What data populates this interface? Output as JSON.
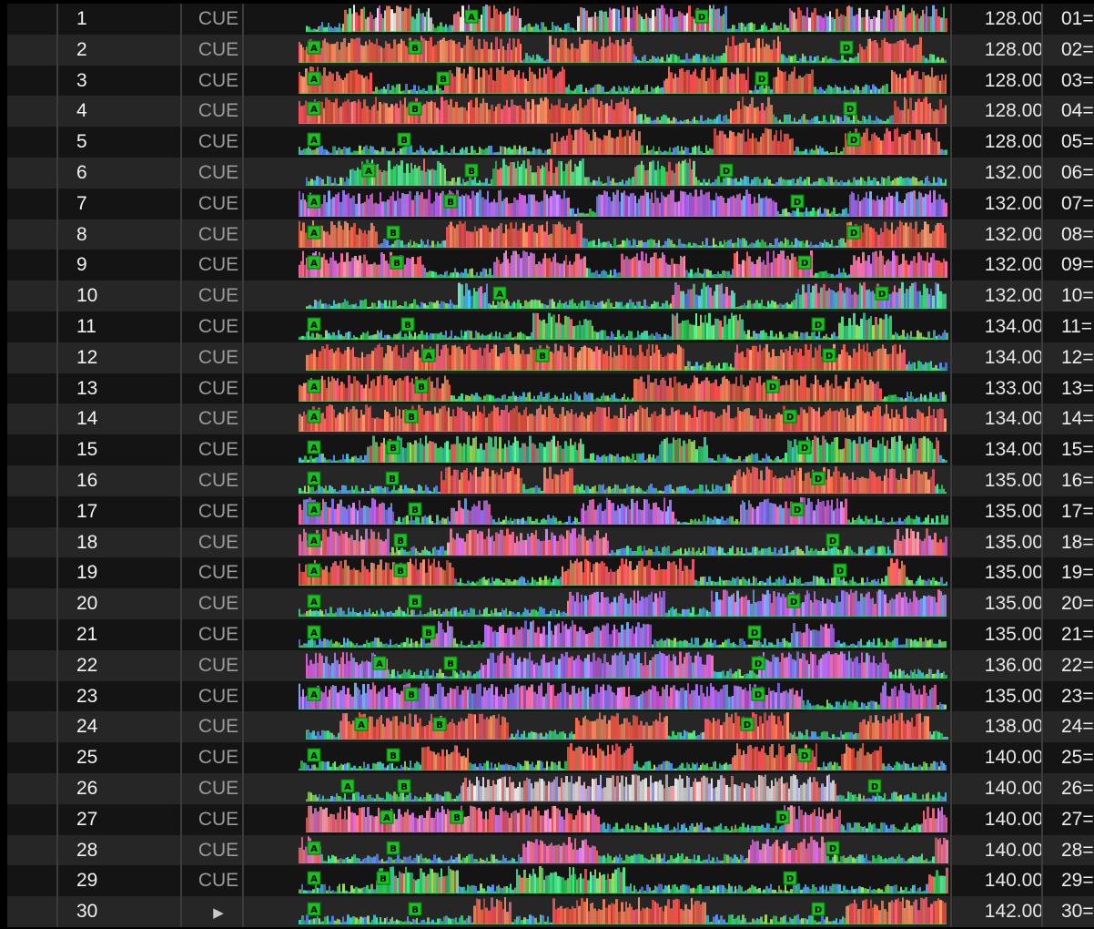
{
  "colors": {
    "row_odd": "#141414",
    "row_even": "#262626",
    "marker_fill": "#17c21d",
    "marker_text": "#000000",
    "waveform_palette": [
      "#ff4d4d",
      "#ff7a55",
      "#e05ad8",
      "#b978ff",
      "#6fa0ff",
      "#3ef08a",
      "#2bd45a",
      "#f0f0f0",
      "#ff9966",
      "#c8d45a"
    ]
  },
  "icons": {
    "playing": "play-icon"
  },
  "tracks": [
    {
      "num": "1",
      "cue": "CUE",
      "bpm": "128.00",
      "key": "01=…",
      "palette": "mixed",
      "markers": [
        {
          "label": "A",
          "pos": 0.23
        },
        {
          "label": "D",
          "pos": 0.555
        }
      ]
    },
    {
      "num": "2",
      "cue": "CUE",
      "bpm": "128.00",
      "key": "02=…",
      "palette": "red",
      "markers": [
        {
          "label": "A",
          "pos": 0.008
        },
        {
          "label": "B",
          "pos": 0.15
        },
        {
          "label": "D",
          "pos": 0.76
        }
      ]
    },
    {
      "num": "3",
      "cue": "CUE",
      "bpm": "128.00",
      "key": "03=…",
      "palette": "red",
      "markers": [
        {
          "label": "A",
          "pos": 0.008
        },
        {
          "label": "B",
          "pos": 0.19
        },
        {
          "label": "D",
          "pos": 0.64
        }
      ]
    },
    {
      "num": "4",
      "cue": "CUE",
      "bpm": "128.00",
      "key": "04=…",
      "palette": "red",
      "markers": [
        {
          "label": "A",
          "pos": 0.008
        },
        {
          "label": "B",
          "pos": 0.15
        },
        {
          "label": "D",
          "pos": 0.765
        }
      ]
    },
    {
      "num": "5",
      "cue": "CUE",
      "bpm": "128.00",
      "key": "05=…",
      "palette": "red",
      "markers": [
        {
          "label": "A",
          "pos": 0.008
        },
        {
          "label": "B",
          "pos": 0.135
        },
        {
          "label": "D",
          "pos": 0.77
        }
      ]
    },
    {
      "num": "6",
      "cue": "CUE",
      "bpm": "132.00",
      "key": "06=…",
      "palette": "green",
      "markers": [
        {
          "label": "A",
          "pos": 0.085
        },
        {
          "label": "B",
          "pos": 0.23
        },
        {
          "label": "D",
          "pos": 0.59
        }
      ]
    },
    {
      "num": "7",
      "cue": "CUE",
      "bpm": "132.00",
      "key": "07=…",
      "palette": "purple",
      "markers": [
        {
          "label": "A",
          "pos": 0.008
        },
        {
          "label": "B",
          "pos": 0.2
        },
        {
          "label": "D",
          "pos": 0.69
        }
      ]
    },
    {
      "num": "8",
      "cue": "CUE",
      "bpm": "132.00",
      "key": "08=…",
      "palette": "red",
      "markers": [
        {
          "label": "A",
          "pos": 0.008
        },
        {
          "label": "B",
          "pos": 0.12
        },
        {
          "label": "D",
          "pos": 0.77
        }
      ]
    },
    {
      "num": "9",
      "cue": "CUE",
      "bpm": "132.00",
      "key": "09=…",
      "palette": "pink",
      "markers": [
        {
          "label": "A",
          "pos": 0.008
        },
        {
          "label": "B",
          "pos": 0.125
        },
        {
          "label": "D",
          "pos": 0.7
        }
      ]
    },
    {
      "num": "10",
      "cue": "CUE",
      "bpm": "132.00",
      "key": "10=…",
      "palette": "blue",
      "markers": [
        {
          "label": "A",
          "pos": 0.27
        },
        {
          "label": "D",
          "pos": 0.81
        }
      ]
    },
    {
      "num": "11",
      "cue": "CUE",
      "bpm": "134.00",
      "key": "11=…",
      "palette": "green",
      "markers": [
        {
          "label": "A",
          "pos": 0.008
        },
        {
          "label": "B",
          "pos": 0.14
        },
        {
          "label": "D",
          "pos": 0.72
        }
      ]
    },
    {
      "num": "12",
      "cue": "CUE",
      "bpm": "134.00",
      "key": "12=…",
      "palette": "red",
      "markers": [
        {
          "label": "A",
          "pos": 0.17
        },
        {
          "label": "B",
          "pos": 0.33
        },
        {
          "label": "D",
          "pos": 0.735
        }
      ]
    },
    {
      "num": "13",
      "cue": "CUE",
      "bpm": "133.00",
      "key": "13=…",
      "palette": "red",
      "markers": [
        {
          "label": "A",
          "pos": 0.008
        },
        {
          "label": "B",
          "pos": 0.16
        },
        {
          "label": "D",
          "pos": 0.655
        }
      ]
    },
    {
      "num": "14",
      "cue": "CUE",
      "bpm": "134.00",
      "key": "14=…",
      "palette": "red",
      "markers": [
        {
          "label": "A",
          "pos": 0.008
        },
        {
          "label": "B",
          "pos": 0.145
        },
        {
          "label": "D",
          "pos": 0.68
        }
      ]
    },
    {
      "num": "15",
      "cue": "CUE",
      "bpm": "134.00",
      "key": "15=…",
      "palette": "green",
      "markers": [
        {
          "label": "A",
          "pos": 0.008
        },
        {
          "label": "B",
          "pos": 0.12
        },
        {
          "label": "D",
          "pos": 0.7
        }
      ]
    },
    {
      "num": "16",
      "cue": "CUE",
      "bpm": "135.00",
      "key": "16=…",
      "palette": "red",
      "markers": [
        {
          "label": "A",
          "pos": 0.008
        },
        {
          "label": "B",
          "pos": 0.118
        },
        {
          "label": "D",
          "pos": 0.72
        }
      ]
    },
    {
      "num": "17",
      "cue": "CUE",
      "bpm": "135.00",
      "key": "17=…",
      "palette": "purple",
      "markers": [
        {
          "label": "A",
          "pos": 0.008
        },
        {
          "label": "B",
          "pos": 0.15
        },
        {
          "label": "D",
          "pos": 0.69
        }
      ]
    },
    {
      "num": "18",
      "cue": "CUE",
      "bpm": "135.00",
      "key": "18=…",
      "palette": "pink",
      "markers": [
        {
          "label": "A",
          "pos": 0.008
        },
        {
          "label": "B",
          "pos": 0.13
        },
        {
          "label": "D",
          "pos": 0.74
        }
      ]
    },
    {
      "num": "19",
      "cue": "CUE",
      "bpm": "135.00",
      "key": "19=…",
      "palette": "red",
      "markers": [
        {
          "label": "A",
          "pos": 0.008
        },
        {
          "label": "B",
          "pos": 0.13
        },
        {
          "label": "D",
          "pos": 0.75
        }
      ]
    },
    {
      "num": "20",
      "cue": "CUE",
      "bpm": "135.00",
      "key": "20=…",
      "palette": "purple",
      "markers": [
        {
          "label": "A",
          "pos": 0.008
        },
        {
          "label": "B",
          "pos": 0.15
        },
        {
          "label": "D",
          "pos": 0.685
        }
      ]
    },
    {
      "num": "21",
      "cue": "CUE",
      "bpm": "135.00",
      "key": "21=…",
      "palette": "purple",
      "markers": [
        {
          "label": "A",
          "pos": 0.008
        },
        {
          "label": "B",
          "pos": 0.17
        },
        {
          "label": "D",
          "pos": 0.63
        }
      ]
    },
    {
      "num": "22",
      "cue": "CUE",
      "bpm": "136.00",
      "key": "22=…",
      "palette": "purple",
      "markers": [
        {
          "label": "A",
          "pos": 0.1
        },
        {
          "label": "B",
          "pos": 0.2
        },
        {
          "label": "D",
          "pos": 0.635
        }
      ]
    },
    {
      "num": "23",
      "cue": "CUE",
      "bpm": "135.00",
      "key": "23=…",
      "palette": "purple",
      "markers": [
        {
          "label": "A",
          "pos": 0.008
        },
        {
          "label": "B",
          "pos": 0.145
        },
        {
          "label": "D",
          "pos": 0.635
        }
      ]
    },
    {
      "num": "24",
      "cue": "CUE",
      "bpm": "138.00",
      "key": "24=…",
      "palette": "red",
      "markers": [
        {
          "label": "A",
          "pos": 0.075
        },
        {
          "label": "B",
          "pos": 0.185
        },
        {
          "label": "D",
          "pos": 0.62
        }
      ]
    },
    {
      "num": "25",
      "cue": "CUE",
      "bpm": "140.00",
      "key": "25=…",
      "palette": "red",
      "markers": [
        {
          "label": "A",
          "pos": 0.008
        },
        {
          "label": "B",
          "pos": 0.12
        },
        {
          "label": "D",
          "pos": 0.7
        }
      ]
    },
    {
      "num": "26",
      "cue": "CUE",
      "bpm": "140.00",
      "key": "26=…",
      "palette": "white",
      "markers": [
        {
          "label": "A",
          "pos": 0.055
        },
        {
          "label": "B",
          "pos": 0.135
        },
        {
          "label": "D",
          "pos": 0.8
        }
      ]
    },
    {
      "num": "27",
      "cue": "CUE",
      "bpm": "140.00",
      "key": "27=…",
      "palette": "pink",
      "markers": [
        {
          "label": "A",
          "pos": 0.11
        },
        {
          "label": "B",
          "pos": 0.21
        },
        {
          "label": "D",
          "pos": 0.67
        }
      ]
    },
    {
      "num": "28",
      "cue": "CUE",
      "bpm": "140.00",
      "key": "28=…",
      "palette": "pink",
      "markers": [
        {
          "label": "A",
          "pos": 0.008
        },
        {
          "label": "B",
          "pos": 0.12
        },
        {
          "label": "D",
          "pos": 0.74
        }
      ]
    },
    {
      "num": "29",
      "cue": "CUE",
      "bpm": "140.00",
      "key": "29=…",
      "palette": "green",
      "markers": [
        {
          "label": "A",
          "pos": 0.008
        },
        {
          "label": "B",
          "pos": 0.105
        },
        {
          "label": "D",
          "pos": 0.68
        }
      ]
    },
    {
      "num": "30",
      "cue": "▶",
      "bpm": "142.00",
      "key": "30=…",
      "palette": "red",
      "markers": [
        {
          "label": "A",
          "pos": 0.008
        },
        {
          "label": "B",
          "pos": 0.15
        },
        {
          "label": "D",
          "pos": 0.72
        }
      ]
    }
  ]
}
